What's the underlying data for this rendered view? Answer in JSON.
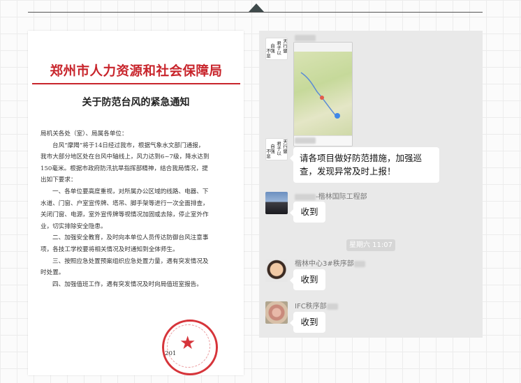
{
  "document": {
    "header": "郑州市人力资源和社会保障局",
    "title": "关于防范台风的紧急通知",
    "body": [
      "局机关各处（室）、局属各单位：",
      "台风“摩羯”将于14日经过我市，根据气象水文部门通报，",
      "我市大部分地区处在台风中轴线上，风力达到6~7级，降水达到",
      "150毫米。根据市政府防汛抗旱指挥部精神，结合我局情况，提",
      "出如下要求：",
      "一、各单位要高度重视，对所属办公区域的线路、电器、下",
      "水道、门窗、户室宣传牌、塔吊、脚手架等进行一次全面排查，",
      "关闭门窗、电源，室外宣传牌等视情况加固或去除，停止室外作",
      "业，切实排除安全隐患。",
      "二、加强安全教育，及时向本单位人员传达防御台风注意事",
      "项，各技工学校要将相关情况及时通知到全体师生。",
      "三、按照应急处置预案组织应急处置力量，遇有突发情况及",
      "时处置。",
      "四、加强值班工作，遇有突发情况及时向局值班室报告。"
    ],
    "date_fragment": "201"
  },
  "chat": {
    "messages": [
      {
        "sender": "",
        "text": ""
      },
      {
        "sender": "",
        "text": "请各项目做好防范措施，加强巡查，发现异常及时上报！"
      },
      {
        "sender": "-楷林国际工程部",
        "text": "收到"
      },
      {
        "sender": "楷林中心3#秩序部",
        "text": "收到"
      },
      {
        "sender": "IFC秩序部",
        "text": "收到"
      }
    ],
    "timestamp": "星期六 11:07",
    "calligraphy_avatar_text": [
      "天",
      "行",
      "健",
      "君",
      "子",
      "以",
      "自",
      "强",
      "不",
      "息"
    ]
  }
}
